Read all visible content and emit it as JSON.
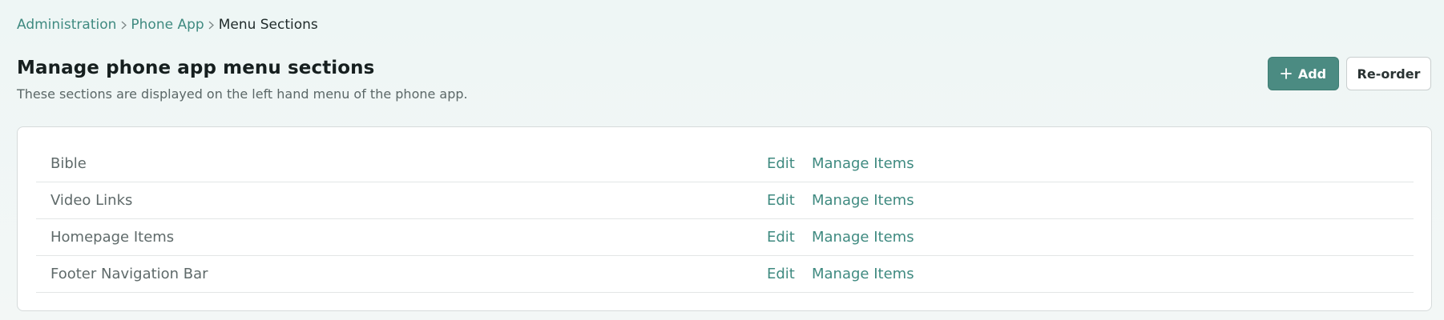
{
  "breadcrumb": {
    "items": [
      {
        "label": "Administration"
      },
      {
        "label": "Phone App"
      },
      {
        "label": "Menu Sections"
      }
    ]
  },
  "header": {
    "title": "Manage phone app menu sections",
    "subtitle": "These sections are displayed on the left hand menu of the phone app."
  },
  "actions": {
    "add_label": "Add",
    "reorder_label": "Re-order"
  },
  "sections": [
    {
      "name": "Bible",
      "edit_label": "Edit",
      "manage_label": "Manage Items"
    },
    {
      "name": "Video Links",
      "edit_label": "Edit",
      "manage_label": "Manage Items"
    },
    {
      "name": "Homepage Items",
      "edit_label": "Edit",
      "manage_label": "Manage Items"
    },
    {
      "name": "Footer Navigation Bar",
      "edit_label": "Edit",
      "manage_label": "Manage Items"
    }
  ],
  "icons": {
    "breadcrumb_separator": "chevron-right-icon",
    "add": "plus-icon"
  },
  "colors": {
    "accent": "#4b8b82",
    "link": "#3f8a80"
  }
}
